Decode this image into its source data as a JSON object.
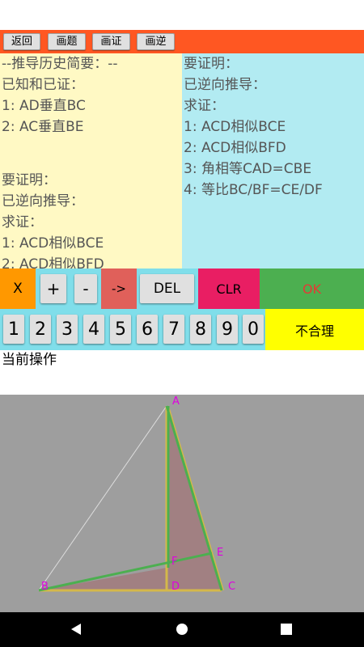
{
  "toolbar": {
    "buttons": [
      "返回",
      "画题",
      "画证",
      "画逆"
    ]
  },
  "left_panel": {
    "lines": [
      "--推导历史简要：--",
      "已知和已证：",
      "1: AD垂直BC",
      "2: AC垂直BE",
      "",
      "要证明：",
      "已逆向推导：",
      "求证：",
      "1: ACD相似BCE",
      "2: ACD相似BFD"
    ]
  },
  "right_panel": {
    "lines": [
      "要证明：",
      "已逆向推导：",
      "求证：",
      "1: ACD相似BCE",
      "2: ACD相似BFD",
      "3: 角相等CAD=CBE",
      "4: 等比BC/BF=CE/DF"
    ]
  },
  "keys": {
    "x": "X",
    "plus": "+",
    "minus": "-",
    "arrow": "->",
    "del": "DEL",
    "clr": "CLR",
    "ok": "OK",
    "digits": [
      "1",
      "2",
      "3",
      "4",
      "5",
      "6",
      "7",
      "8",
      "9",
      "0"
    ],
    "unreasonable": "不合理"
  },
  "status": {
    "label": "当前操作"
  },
  "diagram": {
    "points": {
      "A": "A",
      "B": "B",
      "C": "C",
      "D": "D",
      "E": "E",
      "F": "F"
    }
  },
  "colors": {
    "toolbar": "#ff5722",
    "left_panel": "#fff9c4",
    "right_panel": "#b2ebf2",
    "key_strip": "#80deea",
    "x_key": "#ff9800",
    "arrow_key": "#e0605a",
    "clr_key": "#e91e63",
    "ok_key": "#4caf50",
    "unreasonable_key": "#ffff00",
    "canvas": "#9e9e9e",
    "point_label": "#e000e0"
  },
  "icons": {
    "back": "back-triangle-icon",
    "home": "home-circle-icon",
    "recents": "recents-square-icon"
  }
}
